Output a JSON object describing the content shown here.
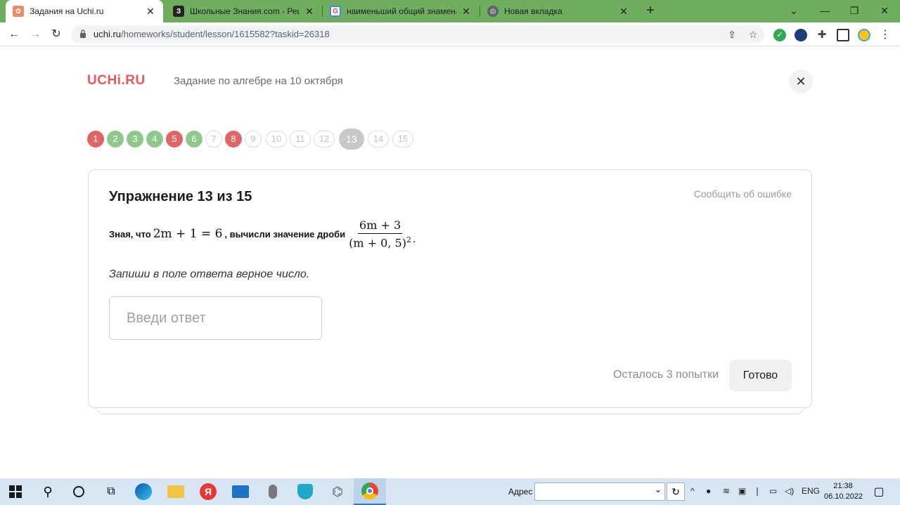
{
  "browser": {
    "tabs": [
      {
        "title": "Задания на Uchi.ru",
        "active": true
      },
      {
        "title": "Школьные Знания.com - Решае",
        "active": false
      },
      {
        "title": "наименьший общий знаменате",
        "active": false
      },
      {
        "title": "Новая вкладка",
        "active": false
      }
    ],
    "url_host": "uchi.ru",
    "url_path": "/homeworks/student/lesson/1615582?taskid=26318"
  },
  "header": {
    "logo": "UCHi.RU",
    "subject": "Задание по алгебре на 10 октября"
  },
  "steps": [
    {
      "label": "1",
      "state": "red"
    },
    {
      "label": "2",
      "state": "green"
    },
    {
      "label": "3",
      "state": "green"
    },
    {
      "label": "4",
      "state": "green"
    },
    {
      "label": "5",
      "state": "red"
    },
    {
      "label": "6",
      "state": "green"
    },
    {
      "label": "7",
      "state": "todo"
    },
    {
      "label": "8",
      "state": "red"
    },
    {
      "label": "9",
      "state": "todo"
    },
    {
      "label": "10",
      "state": "todo"
    },
    {
      "label": "11",
      "state": "todo"
    },
    {
      "label": "12",
      "state": "todo"
    },
    {
      "label": "13",
      "state": "current"
    },
    {
      "label": "14",
      "state": "todo"
    },
    {
      "label": "15",
      "state": "todo"
    }
  ],
  "exercise": {
    "title": "Упражнение 13 из 15",
    "report_link": "Сообщить об ошибке",
    "task_prefix": "Зная, что",
    "condition": "2m + 1 = 6",
    "task_middle": ", вычисли значение дроби",
    "fraction_numerator": "6m + 3",
    "fraction_denominator": "(m + 0, 5)",
    "fraction_exponent": "2",
    "hint": "Запиши в поле ответа верное число.",
    "answer_placeholder": "Введи ответ",
    "attempts": "Осталось 3 попытки",
    "submit_label": "Готово"
  },
  "taskbar": {
    "address_label": "Адрес",
    "language": "ENG",
    "time": "21:38",
    "date": "06.10.2022"
  },
  "colors": {
    "tabbar": "#6fae5e",
    "logo": "#e55a5a",
    "step_red": "#e06666",
    "step_green": "#8ec98b",
    "step_current": "#c8c8c8",
    "taskbar": "#d8e6f3"
  }
}
